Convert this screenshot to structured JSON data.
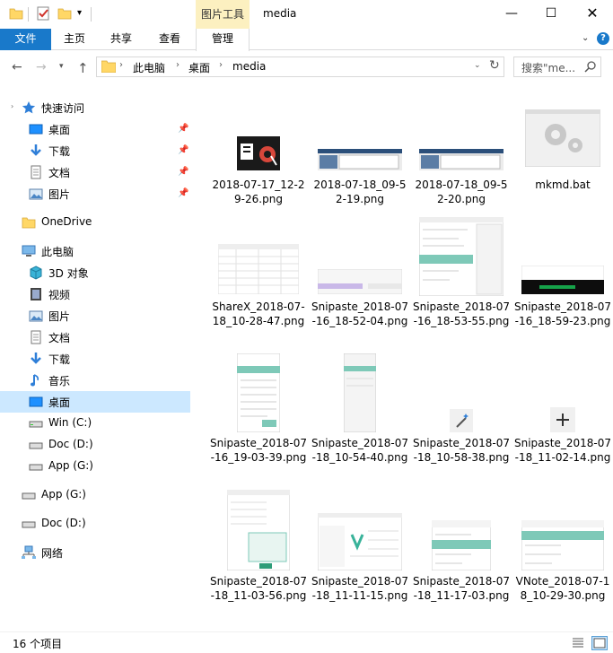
{
  "titlebar": {
    "title": "media",
    "contextual_tab": "图片工具",
    "minimize_icon": "minimize-icon",
    "maximize_icon": "maximize-icon",
    "close_icon": "close-icon"
  },
  "ribbon": {
    "tabs": [
      "文件",
      "主页",
      "共享",
      "查看",
      "管理"
    ],
    "colors": {
      "file_tab": "#1979ca",
      "context_tab": "#fcf0c0"
    }
  },
  "address": {
    "crumbs": [
      "此电脑",
      "桌面",
      "media"
    ],
    "search_placeholder": "搜索\"me..."
  },
  "sidebar": {
    "items": [
      {
        "label": "快速访问",
        "icon": "star-icon",
        "pinned": false
      },
      {
        "label": "桌面",
        "icon": "desktop-icon",
        "pinned": true
      },
      {
        "label": "下载",
        "icon": "download-icon",
        "pinned": true
      },
      {
        "label": "文档",
        "icon": "document-icon",
        "pinned": true
      },
      {
        "label": "图片",
        "icon": "pictures-icon",
        "pinned": true
      },
      {
        "label": "OneDrive",
        "icon": "folder-icon",
        "pinned": false
      },
      {
        "label": "此电脑",
        "icon": "computer-icon",
        "pinned": false
      },
      {
        "label": "3D 对象",
        "icon": "3d-objects-icon",
        "pinned": false
      },
      {
        "label": "视频",
        "icon": "video-icon",
        "pinned": false
      },
      {
        "label": "图片",
        "icon": "pictures-icon",
        "pinned": false
      },
      {
        "label": "文档",
        "icon": "document-icon",
        "pinned": false
      },
      {
        "label": "下载",
        "icon": "download-icon",
        "pinned": false
      },
      {
        "label": "音乐",
        "icon": "music-icon",
        "pinned": false
      },
      {
        "label": "桌面",
        "icon": "desktop-icon",
        "pinned": false,
        "selected": true
      },
      {
        "label": "Win (C:)",
        "icon": "drive-icon",
        "pinned": false
      },
      {
        "label": "Doc (D:)",
        "icon": "drive-icon",
        "pinned": false
      },
      {
        "label": "App (G:)",
        "icon": "drive-icon",
        "pinned": false
      },
      {
        "label": "App (G:)",
        "icon": "drive-icon",
        "pinned": false
      },
      {
        "label": "Doc (D:)",
        "icon": "drive-icon",
        "pinned": false
      },
      {
        "label": "网络",
        "icon": "network-icon",
        "pinned": false
      }
    ]
  },
  "files": [
    {
      "name": "2018-07-17_12-29-26.png",
      "thumb": "dark-icons"
    },
    {
      "name": "2018-07-18_09-52-19.png",
      "thumb": "screenshot-wide"
    },
    {
      "name": "2018-07-18_09-52-20.png",
      "thumb": "screenshot-wide"
    },
    {
      "name": "mkmd.bat",
      "thumb": "bat-gears"
    },
    {
      "name": "ShareX_2018-07-18_10-28-47.png",
      "thumb": "sheet"
    },
    {
      "name": "Snipaste_2018-07-16_18-52-04.png",
      "thumb": "purple-strip"
    },
    {
      "name": "Snipaste_2018-07-16_18-53-55.png",
      "thumb": "editor"
    },
    {
      "name": "Snipaste_2018-07-16_18-59-23.png",
      "thumb": "dark-bar"
    },
    {
      "name": "Snipaste_2018-07-16_19-03-39.png",
      "thumb": "tall-dialog"
    },
    {
      "name": "Snipaste_2018-07-18_10-54-40.png",
      "thumb": "tall-narrow"
    },
    {
      "name": "Snipaste_2018-07-18_10-58-38.png",
      "thumb": "wand-icon"
    },
    {
      "name": "Snipaste_2018-07-18_11-02-14.png",
      "thumb": "plus-icon"
    },
    {
      "name": "Snipaste_2018-07-18_11-03-56.png",
      "thumb": "form-dialog"
    },
    {
      "name": "Snipaste_2018-07-18_11-11-15.png",
      "thumb": "vnote-window"
    },
    {
      "name": "Snipaste_2018-07-18_11-17-03.png",
      "thumb": "menu-dialog"
    },
    {
      "name": "VNote_2018-07-18_10-29-30.png",
      "thumb": "menu-dialog"
    }
  ],
  "status": {
    "count": "16 个项目"
  }
}
